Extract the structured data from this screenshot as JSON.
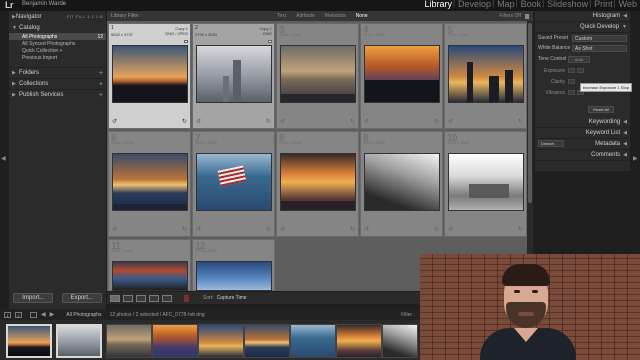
{
  "app": {
    "logo": "Lr",
    "user": "Benjamin Warde",
    "modules": [
      "Library",
      "Develop",
      "Map",
      "Book",
      "Slideshow",
      "Print",
      "Web"
    ],
    "active_module": "Library"
  },
  "left_panel": {
    "navigator": {
      "label": "Navigator",
      "modes": "FIT  FILL  1:1  1:8"
    },
    "catalog": {
      "label": "Catalog",
      "items": [
        {
          "label": "All Photographs",
          "count": "12"
        },
        {
          "label": "All Synced Photographs",
          "count": ""
        },
        {
          "label": "Quick Collection +",
          "count": ""
        },
        {
          "label": "Previous Import",
          "count": ""
        }
      ]
    },
    "sections": [
      "Folders",
      "Collections",
      "Publish Services"
    ],
    "import_label": "Import...",
    "export_label": "Export..."
  },
  "filter_bar": {
    "title": "Library Filter :",
    "options": [
      "Text",
      "Attribute",
      "Metadata",
      "None"
    ],
    "active": "None",
    "filters_off": "Filters Off"
  },
  "grid": {
    "cells": [
      {
        "num": "1",
        "dims": "5632 x 3737",
        "copy": "Copy 1",
        "format": "DNG / JPEG",
        "state": "selected"
      },
      {
        "num": "2",
        "dims": "2790 x 3024",
        "copy": "Copy 1",
        "format": "DNG",
        "state": "selected-secondary"
      },
      {
        "num": "3",
        "dims": "1440 x 1080",
        "copy": "",
        "format": "",
        "state": ""
      },
      {
        "num": "4",
        "dims": "1200 x 1080",
        "copy": "",
        "format": "",
        "state": ""
      },
      {
        "num": "5",
        "dims": "1772 x 2657",
        "copy": "",
        "format": "",
        "state": ""
      },
      {
        "num": "6",
        "dims": "4844 x 3495",
        "copy": "",
        "format": "",
        "state": ""
      },
      {
        "num": "7",
        "dims": "3400 x 3000",
        "copy": "",
        "format": "",
        "state": ""
      },
      {
        "num": "8",
        "dims": "5760 x 3840",
        "copy": "",
        "format": "",
        "state": ""
      },
      {
        "num": "9",
        "dims": "3000 x 2000",
        "copy": "",
        "format": "",
        "state": ""
      },
      {
        "num": "10",
        "dims": "3000 x 2000",
        "copy": "",
        "format": "",
        "state": ""
      },
      {
        "num": "11",
        "dims": "3900 x 2600",
        "copy": "",
        "format": "",
        "state": ""
      },
      {
        "num": "12",
        "dims": "2700 x 1800",
        "copy": "",
        "format": "",
        "state": ""
      }
    ]
  },
  "right_panel": {
    "histogram": "Histogram",
    "quick_develop": "Quick Develop",
    "saved_preset_label": "Saved Preset",
    "saved_preset_value": "Custom",
    "white_balance_label": "White Balance",
    "white_balance_value": "As Shot",
    "tone_control_label": "Tone Control",
    "auto_label": "Auto",
    "adjustments": [
      "Exposure",
      "Clarity",
      "Vibrance"
    ],
    "tooltip": "Increase Exposure 1 Stop",
    "reset_all": "Reset All",
    "keywording": "Keywording",
    "keyword_list": "Keyword List",
    "metadata": "Metadata",
    "metadata_preset": "Default",
    "comments": "Comments"
  },
  "toolbar": {
    "sort_label": "Sort:",
    "sort_value": "Capture Time"
  },
  "filmstrip_bar": {
    "page_1": "1",
    "page_2": "2",
    "source": "All Photographs",
    "count": "12 photos / 2 selected / AFC_0778-hdr.dng",
    "filter_label": "Filter :"
  }
}
